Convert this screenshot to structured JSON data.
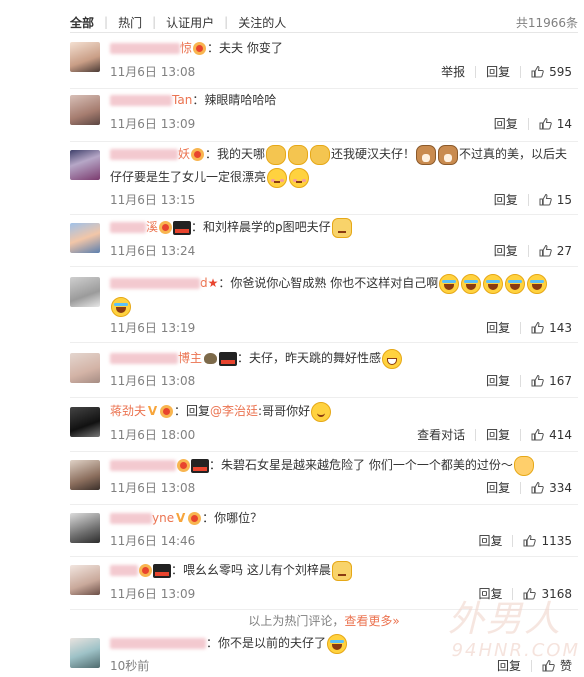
{
  "tabs": [
    "全部",
    "热门",
    "认证用户",
    "关注的人"
  ],
  "total": "共11966条",
  "accent": "#eb7350",
  "comments": [
    {
      "name_suffix": "惊",
      "text": "：夫夫 你变了",
      "time": "11月6日 13:08",
      "report": "举报",
      "reply": "回复",
      "likes": "595"
    },
    {
      "name_suffix": "Tan",
      "text": "：辣眼睛哈哈哈",
      "time": "11月6日 13:09",
      "reply": "回复",
      "likes": "14"
    },
    {
      "name_suffix": "妖",
      "text_a": "：我的天哪",
      "text_b": "还我硬汉夫仔！",
      "text_c": "不过真的美，以后夫",
      "text_d": "仔仔要是生了女儿一定很漂亮",
      "time": "11月6日 13:15",
      "reply": "回复",
      "likes": "15"
    },
    {
      "name_suffix": "溪",
      "text": "：和刘梓晨学的p图吧夫仔",
      "time": "11月6日 13:24",
      "reply": "回复",
      "likes": "27"
    },
    {
      "name_suffix": "d",
      "text": "：你爸说你心智成熟 你也不这样对自己啊",
      "time": "11月6日 13:19",
      "reply": "回复",
      "likes": "143"
    },
    {
      "name_suffix": "博主",
      "text": "：夫仔，昨天跳的舞好性感",
      "time": "11月6日 13:08",
      "reply": "回复",
      "likes": "167"
    },
    {
      "name": "蒋劲夫",
      "text_prefix": "：回复",
      "mention": "@李治廷",
      "text": ":哥哥你好",
      "time": "11月6日 18:00",
      "view_dialog": "查看对话",
      "reply": "回复",
      "likes": "414"
    },
    {
      "text": "：朱碧石女星是越来越危险了 你们一个一个都美的过份～",
      "time": "11月6日 13:08",
      "reply": "回复",
      "likes": "334"
    },
    {
      "name_suffix": "yne",
      "text": "：你哪位？",
      "time": "11月6日 14:46",
      "reply": "回复",
      "likes": "1135"
    },
    {
      "text": "：喂幺幺零吗 这儿有个刘梓晨",
      "time": "11月6日 13:09",
      "reply": "回复",
      "likes": "3168"
    },
    {
      "text": "：你不是以前的夫仔了",
      "time": "10秒前",
      "reply": "回复",
      "likes": "赞"
    }
  ],
  "hot_footer_text": "以上为热门评论，",
  "hot_footer_link": "查看更多»",
  "watermark": "外男人",
  "watermark_url": "94HNR.COM"
}
